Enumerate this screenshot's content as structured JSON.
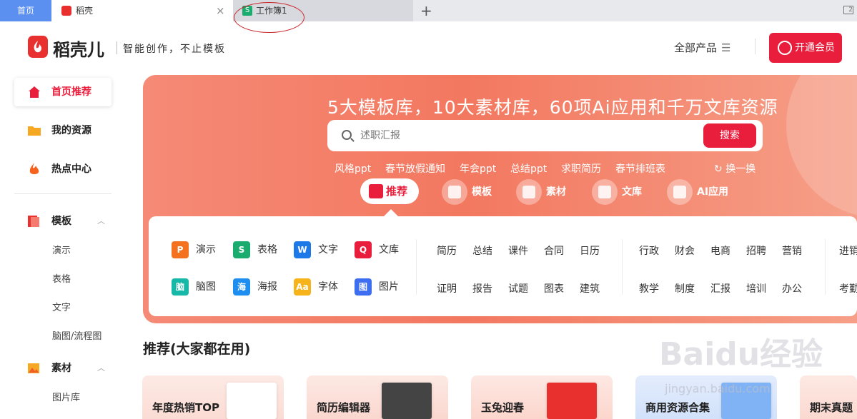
{
  "tabs": {
    "home": "首页",
    "doc": "稻壳",
    "sheet": "工作簿1",
    "add": "+",
    "sheet_icon": "S"
  },
  "brand": {
    "name": "稻壳儿",
    "slogan": "智能创作，不止模板"
  },
  "header": {
    "all_products": "全部产品",
    "vip_button": "开通会员"
  },
  "sidebar": {
    "main": [
      "首页推荐",
      "我的资源",
      "热点中心"
    ],
    "groups": [
      {
        "label": "模板",
        "items": [
          "演示",
          "表格",
          "文字",
          "脑图/流程图"
        ]
      },
      {
        "label": "素材",
        "items": [
          "图片库"
        ]
      }
    ]
  },
  "banner": {
    "title": "5大模板库，10大素材库，60项Ai应用和千万文库资源",
    "search_placeholder": "述职汇报",
    "search_button": "搜索",
    "hot": [
      "风格ppt",
      "春节放假通知",
      "年会ppt",
      "总结ppt",
      "求职简历",
      "春节排班表"
    ],
    "refresh": "换一换",
    "categories": [
      "推荐",
      "模板",
      "素材",
      "文库",
      "AI应用"
    ]
  },
  "panel": {
    "tools": [
      {
        "label": "演示",
        "icon": "P",
        "color": "#f4711f"
      },
      {
        "label": "表格",
        "icon": "S",
        "color": "#1aab6e"
      },
      {
        "label": "文字",
        "icon": "W",
        "color": "#1e79e8"
      },
      {
        "label": "文库",
        "icon": "Q",
        "color": "#e81e3c"
      },
      {
        "label": "脑图",
        "icon": "脑",
        "color": "#16b8a8"
      },
      {
        "label": "海报",
        "icon": "海",
        "color": "#1e8ef0"
      },
      {
        "label": "字体",
        "icon": "Aa",
        "color": "#f6b31a"
      },
      {
        "label": "图片",
        "icon": "图",
        "color": "#3d6ef2"
      }
    ],
    "col1": [
      "简历",
      "总结",
      "课件",
      "合同",
      "日历",
      "证明",
      "报告",
      "试题",
      "图表",
      "建筑"
    ],
    "col2": [
      "行政",
      "财会",
      "电商",
      "招聘",
      "营销",
      "教学",
      "制度",
      "汇报",
      "培训",
      "办公"
    ],
    "col3": [
      "进销",
      "考勤"
    ]
  },
  "recommend": {
    "title": "推荐(大家都在用)",
    "cards": [
      "年度热销TOP",
      "简历编辑器",
      "玉兔迎春",
      "商用资源合集",
      "期末真题"
    ]
  },
  "watermark": {
    "main": "Baidu经验",
    "sub": "jingyan.baidu.com"
  }
}
